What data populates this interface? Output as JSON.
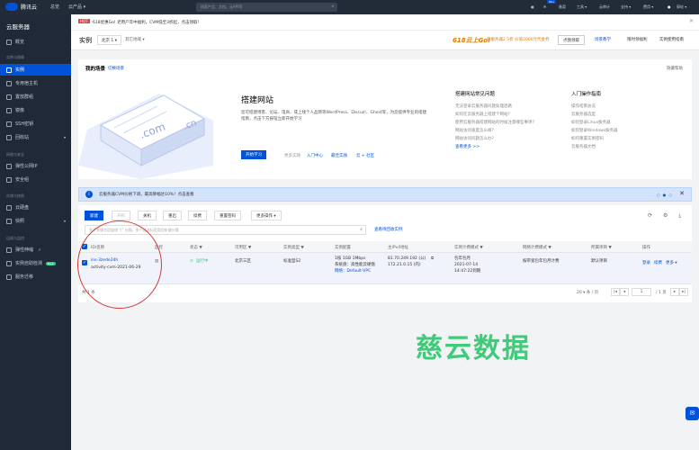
{
  "topbar": {
    "logo": "腾讯云",
    "nav": [
      "总览",
      "云产品 ▾"
    ],
    "search_placeholder": "搜索产品、文档、云API等",
    "right": [
      "备案",
      "工具 ▾",
      "云审计",
      "支持 ▾",
      "费用 ▾",
      "郭屹 ▾"
    ],
    "msg_count": "99+"
  },
  "sidebar": {
    "title": "云服务器",
    "items": [
      {
        "label": "概览"
      },
      {
        "group": "实例与镜像"
      },
      {
        "label": "实例",
        "active": true
      },
      {
        "label": "专用宿主机"
      },
      {
        "label": "置放群组"
      },
      {
        "label": "镜像"
      },
      {
        "label": "SSH密钥"
      },
      {
        "label": "回收站",
        "chevron": "▾"
      },
      {
        "group": "网络与安全"
      },
      {
        "label": "弹性公网IP"
      },
      {
        "label": "安全组"
      },
      {
        "group": "存储与快照"
      },
      {
        "label": "云硬盘"
      },
      {
        "label": "快照",
        "chevron": "▾"
      },
      {
        "group": "运维与监控"
      },
      {
        "label": "弹性伸缩",
        "chevron": "↗"
      },
      {
        "label": "实例自助检测",
        "badge": "New"
      },
      {
        "label": "服务迁移"
      }
    ]
  },
  "notice": {
    "hot": "HOT",
    "text": "618优惠Go! 老用户年中福利，CVM低至3折起，点击领取！",
    "close": "✕"
  },
  "header": {
    "title": "实例",
    "region": "北京 1 ▾",
    "project": "其它地域 ▾",
    "promo": "618云上Go!",
    "promo_sub": "云服务器2.5折 价值2000元代金券",
    "promo_btn": "点我领取",
    "links": [
      "场景教学",
      "限时领福利",
      "实例使用指南"
    ]
  },
  "scene": {
    "section_title": "我的场景",
    "switch": "切换场景",
    "hide": "隐藏帮助",
    "heading": "搭建网站",
    "description": "您可搭建博客、论坛、电商、或上线个人品牌等WordPress、Discuz!、Ghost等，为您提供专业的搭建指南，点击下方按钮立即开始学习",
    "start_btn": "开始学习",
    "more_label": "更多实践",
    "more_links": [
      "入门中心",
      "最佳实践",
      "云 + 社区"
    ],
    "col1_title": "搭建网站常见问题",
    "col1_items": [
      "无法登录云服务器问题处理思路",
      "如何在云服务器上搭建个网站?",
      "使用云服务器搭建网站的时候注意哪些事项?",
      "网站访问速度怎么样?",
      "网站访问问题怎么办?",
      "查看更多 >>"
    ],
    "col2_title": "入门操作指南",
    "col2_items": [
      "操作指南总览",
      "云服务器选型",
      "如何登录Linux服务器",
      "如何登录Windows服务器",
      "如何重置实例密码",
      "云服务器文档"
    ],
    "illus_text": [
      ".com",
      ".cn"
    ]
  },
  "alert": {
    "text": "云服务器CVM价格下调，最高降幅达10%！点击查看",
    "dots": "○ ● ○",
    "close": "✕"
  },
  "toolbar": {
    "buttons": [
      "新建",
      "开机",
      "关机",
      "重启",
      "续费",
      "重置密码",
      "更多操作 ▾"
    ],
    "icons": "⟳ ⚙ ⤓"
  },
  "filter": {
    "placeholder": "多个关键字用竖线 \"|\" 分隔，多个过滤标签用回车键分隔",
    "recycle": "查看待回收实例"
  },
  "table": {
    "headers": [
      "ID/名称",
      "监控",
      "状态 ▼",
      "可用区 ▼",
      "实例类型 ▼",
      "实例配置",
      "主IPv4地址",
      "实例计费模式 ▼",
      "网络计费模式 ▼",
      "所属项目 ▼",
      "操作"
    ],
    "rows": [
      {
        "id": "ins-3zede24h",
        "name": "activity-cvm-2021-06-29",
        "status": "运行中",
        "zone": "北京三区",
        "type": "标准型S2",
        "config": [
          "1核 1GB 1Mbps",
          "系统盘：高性能云硬盘",
          "网络：Default-VPC"
        ],
        "ip": [
          "81.70.249.192 (公)",
          "172.21.0.15 (内)"
        ],
        "billing": [
          "包年包月",
          "2021-07-14",
          "14:47:22到期"
        ],
        "net_billing": "按带宽包年包月计费",
        "project": "默认项目",
        "ops": [
          "登录",
          "续费",
          "更多 ▾"
        ]
      }
    ]
  },
  "pagination": {
    "total": "共 1 条",
    "per_page": "20 ▾ 条 / 页",
    "page": "1",
    "of": "/ 1 页"
  },
  "watermark": "慈云数据",
  "colors": {
    "brand": "#0052d9",
    "topbar": "#222b38",
    "sidebar": "#1f2937",
    "running": "#29cc85",
    "annotation": "#d23a3a",
    "watermark": "#22c465"
  }
}
